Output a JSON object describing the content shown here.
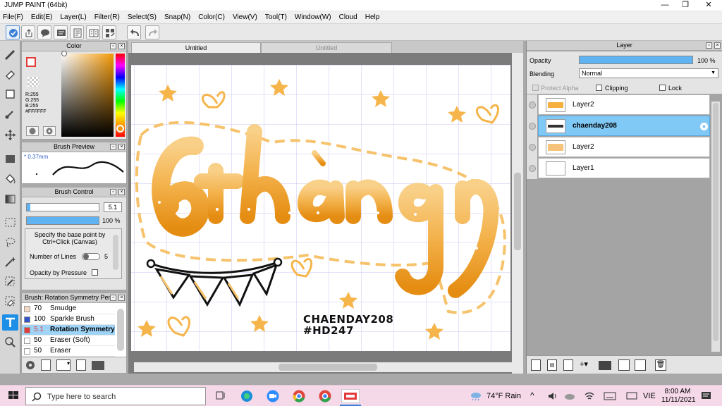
{
  "window": {
    "title": "JUMP PAINT (64bit)",
    "minimize": "—",
    "maximize": "❐",
    "close": "✕"
  },
  "menu": [
    "File(F)",
    "Edit(E)",
    "Layer(L)",
    "Filter(R)",
    "Select(S)",
    "Snap(N)",
    "Color(C)",
    "View(V)",
    "Tool(T)",
    "Window(W)",
    "Cloud",
    "Help"
  ],
  "color_panel": {
    "title": "Color",
    "r": "R:255",
    "g": "G:255",
    "b": "B:255",
    "hex": "#FFFFFF",
    "colors": {
      "primary": "#ffffff",
      "accent": "#e23b3b"
    }
  },
  "brush_preview": {
    "title": "Brush Preview",
    "size": "* 0.37mm"
  },
  "brush_control": {
    "title": "Brush Control",
    "size_value": "5.1",
    "size_fraction": 0.05,
    "opacity_value": "100 %",
    "opacity_fraction": 1.0,
    "hint": "Specify the base point by Ctrl+Click (Canvas)",
    "lines_label": "Number of Lines",
    "lines_value": "5",
    "pressure_label": "Opacity by Pressure"
  },
  "brush_list": {
    "title": "Brush: Rotation Symmetry Pen",
    "items": [
      {
        "size": "70",
        "name": "Smudge",
        "color": "#f3d9c5"
      },
      {
        "size": "100",
        "name": "Sparkle Brush",
        "color": "#3355cc"
      },
      {
        "size": "5.1",
        "name": "Rotation Symmetry",
        "color": "#e23b3b"
      },
      {
        "size": "50",
        "name": "Eraser (Soft)",
        "color": "#ffffff"
      },
      {
        "size": "50",
        "name": "Eraser",
        "color": "#ffffff"
      }
    ]
  },
  "tabs": [
    {
      "label": "Untitled"
    },
    {
      "label": "Untitled"
    }
  ],
  "canvas": {
    "lettering_line1": "CHAENDAY208",
    "lettering_line2": "#HD247"
  },
  "layer_panel": {
    "title": "Layer",
    "opacity_label": "Opacity",
    "opacity_value": "100 %",
    "opacity_fraction": 1.0,
    "blending_label": "Blending",
    "blending_value": "Normal",
    "protect_alpha": "Protect Alpha",
    "clipping": "Clipping",
    "lock": "Lock",
    "layers": [
      {
        "name": "Layer2"
      },
      {
        "name": "chaenday208"
      },
      {
        "name": "Layer2"
      },
      {
        "name": "Layer1"
      }
    ]
  },
  "taskbar": {
    "search_placeholder": "Type here to search",
    "weather": "74°F  Rain",
    "lang": "VIE",
    "time": "8:00 AM",
    "date": "11/11/2021"
  }
}
